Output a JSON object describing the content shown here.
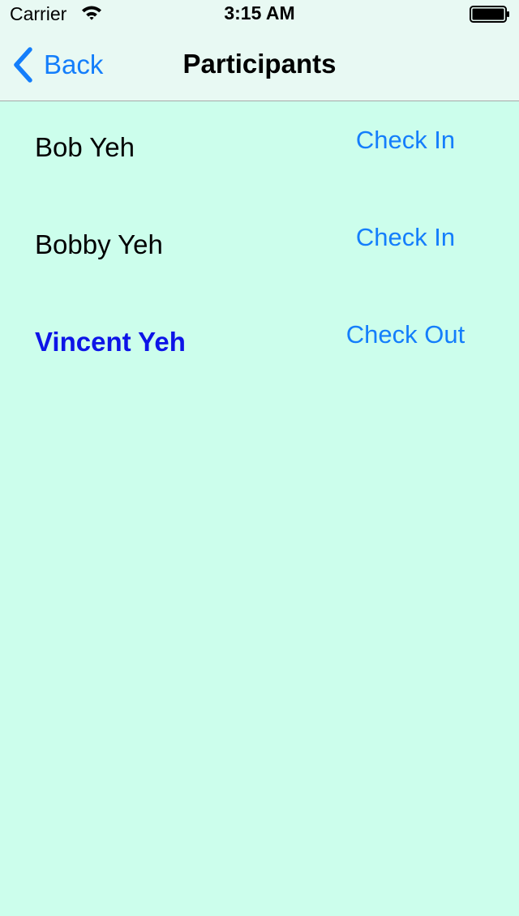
{
  "status_bar": {
    "carrier": "Carrier",
    "time": "3:15 AM",
    "icons": [
      "wifi-icon",
      "battery-icon"
    ]
  },
  "nav_bar": {
    "back_label": "Back",
    "title": "Participants",
    "back_icon": "chevron-left-icon"
  },
  "colors": {
    "background": "#ccfeec",
    "bar_background": "#e8f9f3",
    "accent": "#147efb",
    "selected_name": "#0d14e7"
  },
  "participants": [
    {
      "name": "Bob Yeh",
      "action": "Check In"
    },
    {
      "name": "Bobby Yeh",
      "action": "Check In"
    },
    {
      "name": "Vincent Yeh",
      "action": "Check Out"
    }
  ]
}
